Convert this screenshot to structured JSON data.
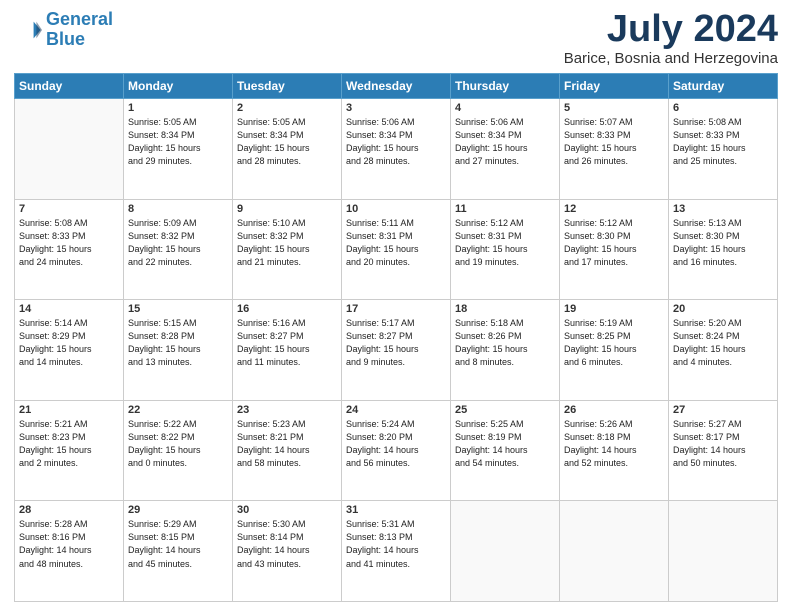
{
  "logo": {
    "line1": "General",
    "line2": "Blue"
  },
  "title": "July 2024",
  "location": "Barice, Bosnia and Herzegovina",
  "days_of_week": [
    "Sunday",
    "Monday",
    "Tuesday",
    "Wednesday",
    "Thursday",
    "Friday",
    "Saturday"
  ],
  "weeks": [
    [
      {
        "num": "",
        "empty": true
      },
      {
        "num": "1",
        "sunrise": "5:05 AM",
        "sunset": "8:34 PM",
        "daylight": "15 hours and 29 minutes."
      },
      {
        "num": "2",
        "sunrise": "5:05 AM",
        "sunset": "8:34 PM",
        "daylight": "15 hours and 28 minutes."
      },
      {
        "num": "3",
        "sunrise": "5:06 AM",
        "sunset": "8:34 PM",
        "daylight": "15 hours and 28 minutes."
      },
      {
        "num": "4",
        "sunrise": "5:06 AM",
        "sunset": "8:34 PM",
        "daylight": "15 hours and 27 minutes."
      },
      {
        "num": "5",
        "sunrise": "5:07 AM",
        "sunset": "8:33 PM",
        "daylight": "15 hours and 26 minutes."
      },
      {
        "num": "6",
        "sunrise": "5:08 AM",
        "sunset": "8:33 PM",
        "daylight": "15 hours and 25 minutes."
      }
    ],
    [
      {
        "num": "7",
        "sunrise": "5:08 AM",
        "sunset": "8:33 PM",
        "daylight": "15 hours and 24 minutes."
      },
      {
        "num": "8",
        "sunrise": "5:09 AM",
        "sunset": "8:32 PM",
        "daylight": "15 hours and 22 minutes."
      },
      {
        "num": "9",
        "sunrise": "5:10 AM",
        "sunset": "8:32 PM",
        "daylight": "15 hours and 21 minutes."
      },
      {
        "num": "10",
        "sunrise": "5:11 AM",
        "sunset": "8:31 PM",
        "daylight": "15 hours and 20 minutes."
      },
      {
        "num": "11",
        "sunrise": "5:12 AM",
        "sunset": "8:31 PM",
        "daylight": "15 hours and 19 minutes."
      },
      {
        "num": "12",
        "sunrise": "5:12 AM",
        "sunset": "8:30 PM",
        "daylight": "15 hours and 17 minutes."
      },
      {
        "num": "13",
        "sunrise": "5:13 AM",
        "sunset": "8:30 PM",
        "daylight": "15 hours and 16 minutes."
      }
    ],
    [
      {
        "num": "14",
        "sunrise": "5:14 AM",
        "sunset": "8:29 PM",
        "daylight": "15 hours and 14 minutes."
      },
      {
        "num": "15",
        "sunrise": "5:15 AM",
        "sunset": "8:28 PM",
        "daylight": "15 hours and 13 minutes."
      },
      {
        "num": "16",
        "sunrise": "5:16 AM",
        "sunset": "8:27 PM",
        "daylight": "15 hours and 11 minutes."
      },
      {
        "num": "17",
        "sunrise": "5:17 AM",
        "sunset": "8:27 PM",
        "daylight": "15 hours and 9 minutes."
      },
      {
        "num": "18",
        "sunrise": "5:18 AM",
        "sunset": "8:26 PM",
        "daylight": "15 hours and 8 minutes."
      },
      {
        "num": "19",
        "sunrise": "5:19 AM",
        "sunset": "8:25 PM",
        "daylight": "15 hours and 6 minutes."
      },
      {
        "num": "20",
        "sunrise": "5:20 AM",
        "sunset": "8:24 PM",
        "daylight": "15 hours and 4 minutes."
      }
    ],
    [
      {
        "num": "21",
        "sunrise": "5:21 AM",
        "sunset": "8:23 PM",
        "daylight": "15 hours and 2 minutes."
      },
      {
        "num": "22",
        "sunrise": "5:22 AM",
        "sunset": "8:22 PM",
        "daylight": "15 hours and 0 minutes."
      },
      {
        "num": "23",
        "sunrise": "5:23 AM",
        "sunset": "8:21 PM",
        "daylight": "14 hours and 58 minutes."
      },
      {
        "num": "24",
        "sunrise": "5:24 AM",
        "sunset": "8:20 PM",
        "daylight": "14 hours and 56 minutes."
      },
      {
        "num": "25",
        "sunrise": "5:25 AM",
        "sunset": "8:19 PM",
        "daylight": "14 hours and 54 minutes."
      },
      {
        "num": "26",
        "sunrise": "5:26 AM",
        "sunset": "8:18 PM",
        "daylight": "14 hours and 52 minutes."
      },
      {
        "num": "27",
        "sunrise": "5:27 AM",
        "sunset": "8:17 PM",
        "daylight": "14 hours and 50 minutes."
      }
    ],
    [
      {
        "num": "28",
        "sunrise": "5:28 AM",
        "sunset": "8:16 PM",
        "daylight": "14 hours and 48 minutes."
      },
      {
        "num": "29",
        "sunrise": "5:29 AM",
        "sunset": "8:15 PM",
        "daylight": "14 hours and 45 minutes."
      },
      {
        "num": "30",
        "sunrise": "5:30 AM",
        "sunset": "8:14 PM",
        "daylight": "14 hours and 43 minutes."
      },
      {
        "num": "31",
        "sunrise": "5:31 AM",
        "sunset": "8:13 PM",
        "daylight": "14 hours and 41 minutes."
      },
      {
        "num": "",
        "empty": true
      },
      {
        "num": "",
        "empty": true
      },
      {
        "num": "",
        "empty": true
      }
    ]
  ]
}
